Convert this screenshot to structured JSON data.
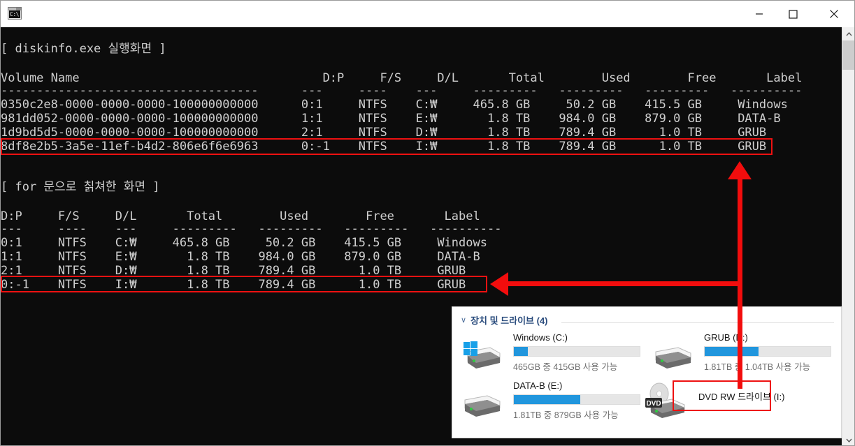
{
  "window": {
    "icon_name": "console-icon",
    "icon_text": "C:\\",
    "title": "",
    "minimize_label": "—",
    "maximize_label": "□",
    "close_label": "✕"
  },
  "console": {
    "section1_heading": "[ diskinfo.exe 실행화면 ]",
    "section1_header": "Volume Name                                  D:P     F/S     D/L       Total        Used        Free       Label",
    "section1_rule": "------------------------------------      ---     ----    ---     ---------   ---------   ---------   ----------",
    "section1_rows": [
      "0350c2e8-0000-0000-0000-100000000000      0:1     NTFS    C:₩     465.8 GB     50.2 GB    415.5 GB     Windows",
      "981dd052-0000-0000-0000-100000000000      1:1     NTFS    E:₩       1.8 TB    984.0 GB    879.0 GB     DATA-B",
      "1d9bd5d5-0000-0000-0000-100000000000      2:1     NTFS    D:₩       1.8 TB    789.4 GB      1.0 TB     GRUB",
      "8df8e2b5-3a5e-11ef-b4d2-806e6f6e6963      0:-1    NTFS    I:₩       1.8 TB    789.4 GB      1.0 TB     GRUB"
    ],
    "section2_heading": "[ for 문으로 칡쳐한 화면 ]",
    "section2_header": "D:P     F/S     D/L       Total        Used        Free       Label",
    "section2_rule": "---     ----    ---     ---------   ---------   ---------   ----------",
    "section2_rows": [
      "0:1     NTFS    C:₩     465.8 GB     50.2 GB    415.5 GB     Windows",
      "1:1     NTFS    E:₩       1.8 TB    984.0 GB    879.0 GB     DATA-B",
      "2:1     NTFS    D:₩       1.8 TB    789.4 GB      1.0 TB     GRUB",
      "0:-1    NTFS    I:₩       1.8 TB    789.4 GB      1.0 TB     GRUB"
    ]
  },
  "annotations": {
    "highlight_color": "#ee1111",
    "arrow_color": "#f20d0d",
    "box1_name": "highlight-diskinfo-row",
    "box2_name": "highlight-for-loop-row",
    "box3_name": "highlight-dvd-drive",
    "arrow_vertical_name": "arrow-dvd-to-diskinfo-row",
    "arrow_horizontal_name": "arrow-dvd-to-for-row"
  },
  "explorer": {
    "group_chevron": "∨",
    "group_title": "장치 및 드라이브 (4)",
    "drives": [
      {
        "name": "Windows (C:)",
        "free_text": "465GB 중 415GB 사용 가능",
        "used_percent": 11,
        "icon_name": "windows-drive-icon",
        "type": "hdd-windows"
      },
      {
        "name": "GRUB (D:)",
        "free_text": "1.81TB 중 1.04TB 사용 가능",
        "used_percent": 43,
        "icon_name": "hard-drive-icon",
        "type": "hdd"
      },
      {
        "name": "DATA-B (E:)",
        "free_text": "1.81TB 중 879GB 사용 가능",
        "used_percent": 53,
        "icon_name": "hard-drive-icon",
        "type": "hdd"
      },
      {
        "name": "DVD RW 드라이브 (I:)",
        "free_text": "",
        "used_percent": 0,
        "icon_name": "dvd-drive-icon",
        "icon_badge": "DVD",
        "type": "dvd"
      }
    ]
  },
  "scrollbar": {
    "up_arrow": "ⱏ",
    "down_arrow": "ⱟ",
    "thumb_name": "scrollbar-thumb"
  }
}
